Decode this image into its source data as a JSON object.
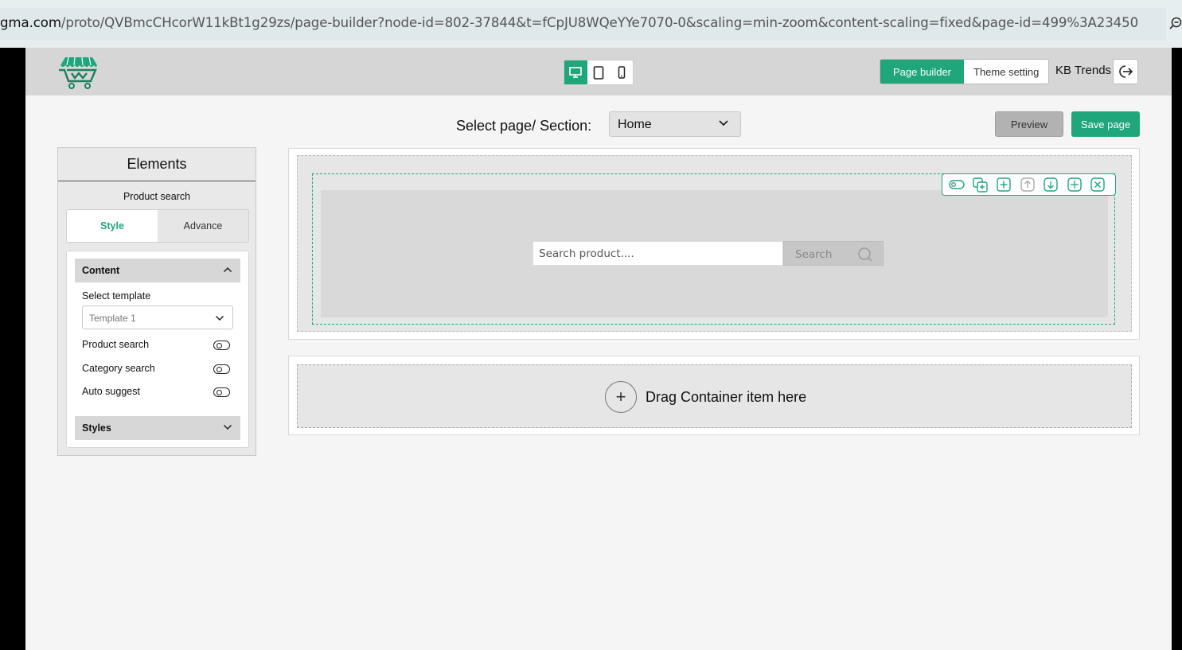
{
  "browser": {
    "url_host": "gma.com",
    "url_path": "/proto/QVBmcCHcorW11kBt1g29zs/page-builder?node-id=802-37844&t=fCpJU8WQeYYe7070-0&scaling=min-zoom&content-scaling=fixed&page-id=499%3A23450"
  },
  "header": {
    "devices": [
      "desktop-icon",
      "tablet-icon",
      "mobile-icon"
    ],
    "active_device": "desktop",
    "mode_page_builder": "Page builder",
    "mode_theme_setting": "Theme setting",
    "store_name": "KB Trends"
  },
  "page_select": {
    "label": "Select page/ Section:",
    "value": "Home"
  },
  "actions": {
    "preview": "Preview",
    "save": "Save page"
  },
  "panel": {
    "title": "Elements",
    "subtitle": "Product search",
    "tab_style": "Style",
    "tab_advance": "Advance",
    "content_header": "Content",
    "template_label": "Select template",
    "template_value": "Template 1",
    "options": [
      "Product search",
      "Category search",
      "Auto suggest"
    ],
    "styles_header": "Styles"
  },
  "canvas": {
    "search_placeholder": "Search product....",
    "search_button": "Search",
    "drop_text": "Drag Container item here"
  },
  "colors": {
    "accent": "#1fa67a",
    "topbar": "#d6d6d6",
    "background": "#f5f5f5"
  }
}
